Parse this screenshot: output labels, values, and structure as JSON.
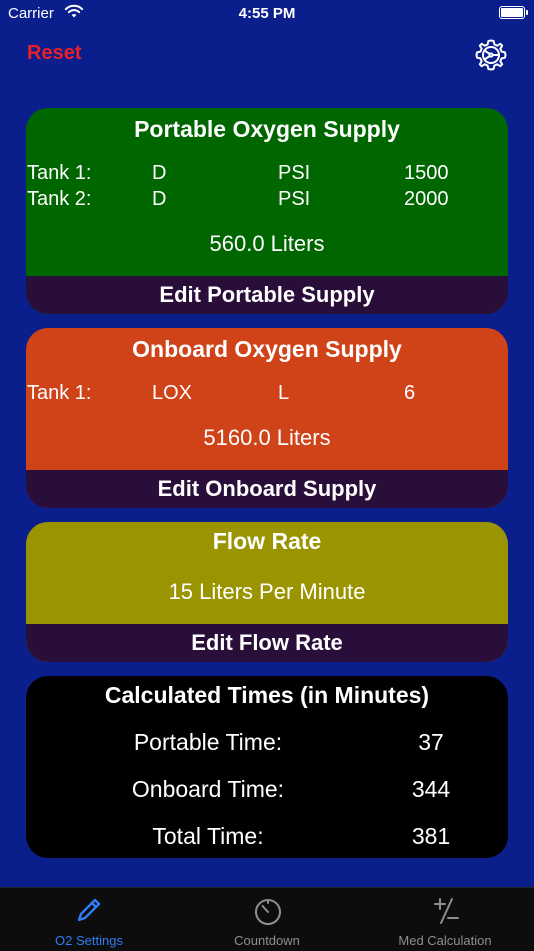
{
  "status_bar": {
    "carrier": "Carrier",
    "time": "4:55 PM"
  },
  "nav": {
    "reset_label": "Reset"
  },
  "portable": {
    "title": "Portable Oxygen Supply",
    "tanks": [
      {
        "label": "Tank 1:",
        "size": "D",
        "unit": "PSI",
        "value": "1500"
      },
      {
        "label": "Tank 2:",
        "size": "D",
        "unit": "PSI",
        "value": "2000"
      }
    ],
    "total": "560.0 Liters",
    "edit_label": "Edit Portable Supply"
  },
  "onboard": {
    "title": "Onboard Oxygen Supply",
    "tanks": [
      {
        "label": "Tank 1:",
        "size": "LOX",
        "unit": "L",
        "value": "6"
      }
    ],
    "total": "5160.0 Liters",
    "edit_label": "Edit Onboard Supply"
  },
  "flow": {
    "title": "Flow Rate",
    "value": "15 Liters Per Minute",
    "edit_label": "Edit Flow Rate"
  },
  "times": {
    "title": "Calculated Times (in Minutes)",
    "rows": [
      {
        "label": "Portable Time:",
        "value": "37"
      },
      {
        "label": "Onboard Time:",
        "value": "344"
      },
      {
        "label": "Total Time:",
        "value": "381"
      }
    ]
  },
  "tabs": [
    {
      "label": "O2 Settings",
      "icon": "pencil-icon",
      "active": true
    },
    {
      "label": "Countdown",
      "icon": "timer-icon",
      "active": false
    },
    {
      "label": "Med Calculation",
      "icon": "plus-minus-icon",
      "active": false
    }
  ],
  "colors": {
    "background": "#0a1e8c",
    "portable_card": "#006600",
    "onboard_card": "#d04218",
    "flow_card": "#9a9400",
    "times_card": "#000000",
    "edit_bar": "#2a0e3a",
    "reset": "#e8202a",
    "tab_active": "#2f7cf6",
    "tab_inactive": "#8e8e93"
  }
}
